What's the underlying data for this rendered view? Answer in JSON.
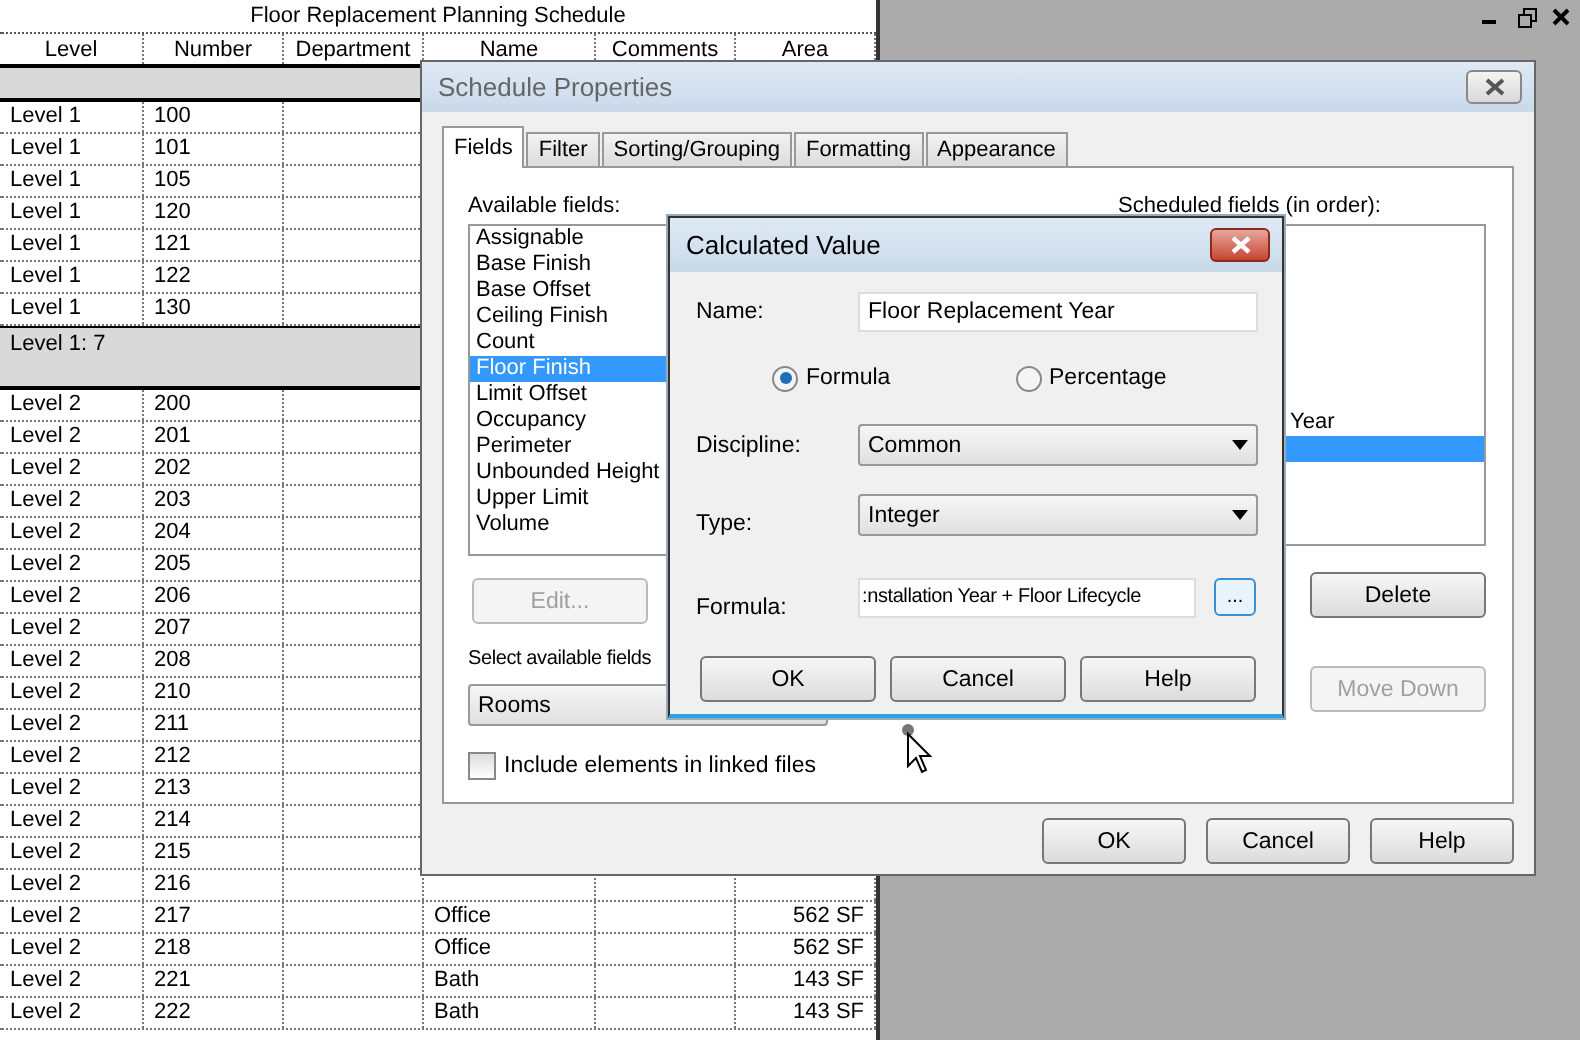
{
  "schedule": {
    "title": "Floor Replacement Planning Schedule",
    "columns": [
      "Level",
      "Number",
      "Department",
      "Name",
      "Comments",
      "Area"
    ],
    "groups": [
      {
        "rows": [
          {
            "level": "Level 1",
            "number": "100"
          },
          {
            "level": "Level 1",
            "number": "101"
          },
          {
            "level": "Level 1",
            "number": "105"
          },
          {
            "level": "Level 1",
            "number": "120"
          },
          {
            "level": "Level 1",
            "number": "121"
          },
          {
            "level": "Level 1",
            "number": "122"
          },
          {
            "level": "Level 1",
            "number": "130"
          }
        ],
        "footer": "Level 1: 7"
      },
      {
        "rows": [
          {
            "level": "Level 2",
            "number": "200"
          },
          {
            "level": "Level 2",
            "number": "201"
          },
          {
            "level": "Level 2",
            "number": "202"
          },
          {
            "level": "Level 2",
            "number": "203"
          },
          {
            "level": "Level 2",
            "number": "204"
          },
          {
            "level": "Level 2",
            "number": "205"
          },
          {
            "level": "Level 2",
            "number": "206"
          },
          {
            "level": "Level 2",
            "number": "207"
          },
          {
            "level": "Level 2",
            "number": "208"
          },
          {
            "level": "Level 2",
            "number": "210"
          },
          {
            "level": "Level 2",
            "number": "211"
          },
          {
            "level": "Level 2",
            "number": "212"
          },
          {
            "level": "Level 2",
            "number": "213"
          },
          {
            "level": "Level 2",
            "number": "214"
          },
          {
            "level": "Level 2",
            "number": "215"
          },
          {
            "level": "Level 2",
            "number": "216"
          },
          {
            "level": "Level 2",
            "number": "217",
            "name": "Office",
            "area": "562 SF"
          },
          {
            "level": "Level 2",
            "number": "218",
            "name": "Office",
            "area": "562 SF"
          },
          {
            "level": "Level 2",
            "number": "221",
            "name": "Bath",
            "area": "143 SF"
          },
          {
            "level": "Level 2",
            "number": "222",
            "name": "Bath",
            "area": "143 SF"
          }
        ]
      }
    ]
  },
  "schedule_properties": {
    "title": "Schedule Properties",
    "tabs": [
      {
        "label": "Fields",
        "selected": true
      },
      {
        "label": "Filter",
        "selected": false
      },
      {
        "label": "Sorting/Grouping",
        "selected": false
      },
      {
        "label": "Formatting",
        "selected": false
      },
      {
        "label": "Appearance",
        "selected": false
      }
    ],
    "available_fields": {
      "label": "Available fields:",
      "items": [
        {
          "text": "Assignable",
          "selected": false
        },
        {
          "text": "Base Finish",
          "selected": false
        },
        {
          "text": "Base Offset",
          "selected": false
        },
        {
          "text": "Ceiling Finish",
          "selected": false
        },
        {
          "text": "Count",
          "selected": false
        },
        {
          "text": "Floor Finish",
          "selected": true
        },
        {
          "text": "Limit Offset",
          "selected": false
        },
        {
          "text": "Occupancy",
          "selected": false
        },
        {
          "text": "Perimeter",
          "selected": false
        },
        {
          "text": "Unbounded Height",
          "selected": false
        },
        {
          "text": "Upper Limit",
          "selected": false
        },
        {
          "text": "Volume",
          "selected": false
        }
      ]
    },
    "scheduled_fields": {
      "label": "Scheduled fields (in order):",
      "items": [
        {
          "text": "Year",
          "selected": false
        },
        {
          "selected": true
        }
      ]
    },
    "edit_button": {
      "label": "Edit...",
      "disabled": true
    },
    "delete_button": {
      "label": "Delete",
      "disabled": false
    },
    "move_down_button": {
      "label": "Move Down",
      "disabled": true
    },
    "select_label": "Select available fields",
    "select_value": "Rooms",
    "include_linked": {
      "label": "Include elements in linked files",
      "checked": false
    },
    "buttons": [
      "OK",
      "Cancel",
      "Help"
    ]
  },
  "calculated_value": {
    "title": "Calculated Value",
    "name": {
      "label": "Name:",
      "value": "Floor Replacement Year"
    },
    "modes": [
      {
        "label": "Formula",
        "selected": true
      },
      {
        "label": "Percentage",
        "selected": false
      }
    ],
    "discipline": {
      "label": "Discipline:",
      "value": "Common"
    },
    "type": {
      "label": "Type:",
      "value": "Integer"
    },
    "formula": {
      "label": "Formula:",
      "value": ":nstallation Year + Floor Lifecycle"
    },
    "browse_button": "...",
    "buttons": [
      "OK",
      "Cancel",
      "Help"
    ]
  }
}
